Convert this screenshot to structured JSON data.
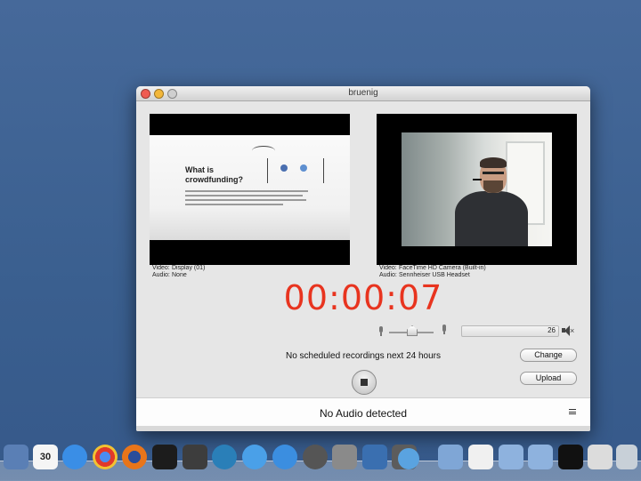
{
  "window": {
    "title": "bruenig"
  },
  "preview_left": {
    "slide_title": "What is crowdfunding?",
    "video_label": "Video:",
    "video_value": "Display (01)",
    "audio_label": "Audio:",
    "audio_value": "None"
  },
  "preview_right": {
    "video_label": "Video:",
    "video_value": "FaceTime HD Camera (Built-in)",
    "audio_label": "Audio:",
    "audio_value": "Sennheiser USB Headset"
  },
  "timer": "00:00:07",
  "audio": {
    "level_value": "26"
  },
  "schedule_text": "No scheduled recordings next 24 hours",
  "buttons": {
    "change": "Change",
    "upload": "Upload"
  },
  "status": {
    "no_audio": "No Audio detected"
  },
  "colors": {
    "timer": "#e8341f",
    "desktop": "#3f6593"
  },
  "dock": {
    "items": [
      {
        "icon": "mail-icon"
      },
      {
        "icon": "calendar-icon",
        "label": "30"
      },
      {
        "icon": "messages-icon"
      },
      {
        "icon": "chrome-icon"
      },
      {
        "icon": "firefox-icon"
      },
      {
        "icon": "terminal-icon"
      },
      {
        "icon": "sublime-icon"
      },
      {
        "icon": "network-icon"
      },
      {
        "icon": "itunes-icon"
      },
      {
        "icon": "app-store-icon"
      },
      {
        "icon": "dvd-icon"
      },
      {
        "icon": "system-prefs-icon"
      },
      {
        "icon": "screen-recorder-icon"
      },
      {
        "icon": "film-icon"
      },
      {
        "icon": "globe-icon"
      },
      {
        "icon": "applications-folder-icon"
      },
      {
        "icon": "documents-icon"
      },
      {
        "icon": "folder-icon"
      },
      {
        "icon": "downloads-folder-icon"
      },
      {
        "icon": "terminal-window-icon"
      },
      {
        "icon": "window-thumbnail-icon"
      },
      {
        "icon": "trash-icon"
      }
    ]
  }
}
